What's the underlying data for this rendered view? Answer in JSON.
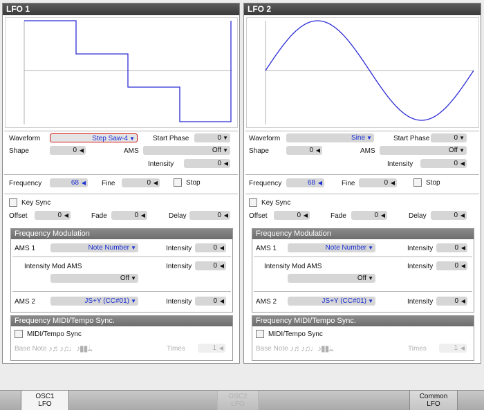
{
  "lfo1": {
    "title": "LFO 1",
    "waveform_label": "Waveform",
    "waveform_value": "Step Saw-4",
    "start_phase_label": "Start Phase",
    "start_phase_value": "0",
    "shape_label": "Shape",
    "shape_value": "0",
    "ams_label": "AMS",
    "ams_value": "Off",
    "intensity_label": "Intensity",
    "intensity_value": "0",
    "frequency_label": "Frequency",
    "frequency_value": "68",
    "fine_label": "Fine",
    "fine_value": "0",
    "stop_label": "Stop",
    "key_sync_label": "Key Sync",
    "offset_label": "Offset",
    "offset_value": "0",
    "fade_label": "Fade",
    "fade_value": "0",
    "delay_label": "Delay",
    "delay_value": "0",
    "freq_mod": {
      "title": "Frequency Modulation",
      "ams1_label": "AMS 1",
      "ams1_value": "Note Number",
      "ams1_int_label": "Intensity",
      "ams1_int_value": "0",
      "int_mod_ams_label": "Intensity Mod AMS",
      "int_mod_int_label": "Intensity",
      "int_mod_int_value": "0",
      "int_mod_ams_value": "Off",
      "ams2_label": "AMS 2",
      "ams2_value": "JS+Y  (CC#01)",
      "ams2_int_label": "Intensity",
      "ams2_int_value": "0"
    },
    "midi_sync": {
      "title": "Frequency MIDI/Tempo Sync.",
      "midi_tempo_label": "MIDI/Tempo Sync",
      "base_note_label": "Base Note",
      "times_label": "Times",
      "times_value": "1"
    }
  },
  "lfo2": {
    "title": "LFO 2",
    "waveform_label": "Waveform",
    "waveform_value": "Sine",
    "start_phase_label": "Start Phase",
    "start_phase_value": "0",
    "shape_label": "Shape",
    "shape_value": "0",
    "ams_label": "AMS",
    "ams_value": "Off",
    "intensity_label": "Intensity",
    "intensity_value": "0",
    "frequency_label": "Frequency",
    "frequency_value": "68",
    "fine_label": "Fine",
    "fine_value": "0",
    "stop_label": "Stop",
    "key_sync_label": "Key Sync",
    "offset_label": "Offset",
    "offset_value": "0",
    "fade_label": "Fade",
    "fade_value": "0",
    "delay_label": "Delay",
    "delay_value": "0",
    "freq_mod": {
      "title": "Frequency Modulation",
      "ams1_label": "AMS 1",
      "ams1_value": "Note Number",
      "ams1_int_label": "Intensity",
      "ams1_int_value": "0",
      "int_mod_ams_label": "Intensity Mod AMS",
      "int_mod_int_label": "Intensity",
      "int_mod_int_value": "0",
      "int_mod_ams_value": "Off",
      "ams2_label": "AMS 2",
      "ams2_value": "JS+Y  (CC#01)",
      "ams2_int_label": "Intensity",
      "ams2_int_value": "0"
    },
    "midi_sync": {
      "title": "Frequency MIDI/Tempo Sync.",
      "midi_tempo_label": "MIDI/Tempo Sync",
      "base_note_label": "Base Note",
      "times_label": "Times",
      "times_value": "1"
    }
  },
  "tabs": {
    "osc1_lfo_line1": "OSC1",
    "osc1_lfo_line2": "LFO",
    "osc2_lfo_line1": "OSC2",
    "osc2_lfo_line2": "LFO",
    "common_lfo_line1": "Common",
    "common_lfo_line2": "LFO"
  },
  "colors": {
    "accent_blue": "#1a2fd4",
    "waveform_line": "#2b2bd6",
    "error_border": "#d01010"
  },
  "icons": {
    "dropdown": "triangle-down-icon",
    "stepper": "triangle-left-icon",
    "note_glyphs": "music-note-icons"
  }
}
